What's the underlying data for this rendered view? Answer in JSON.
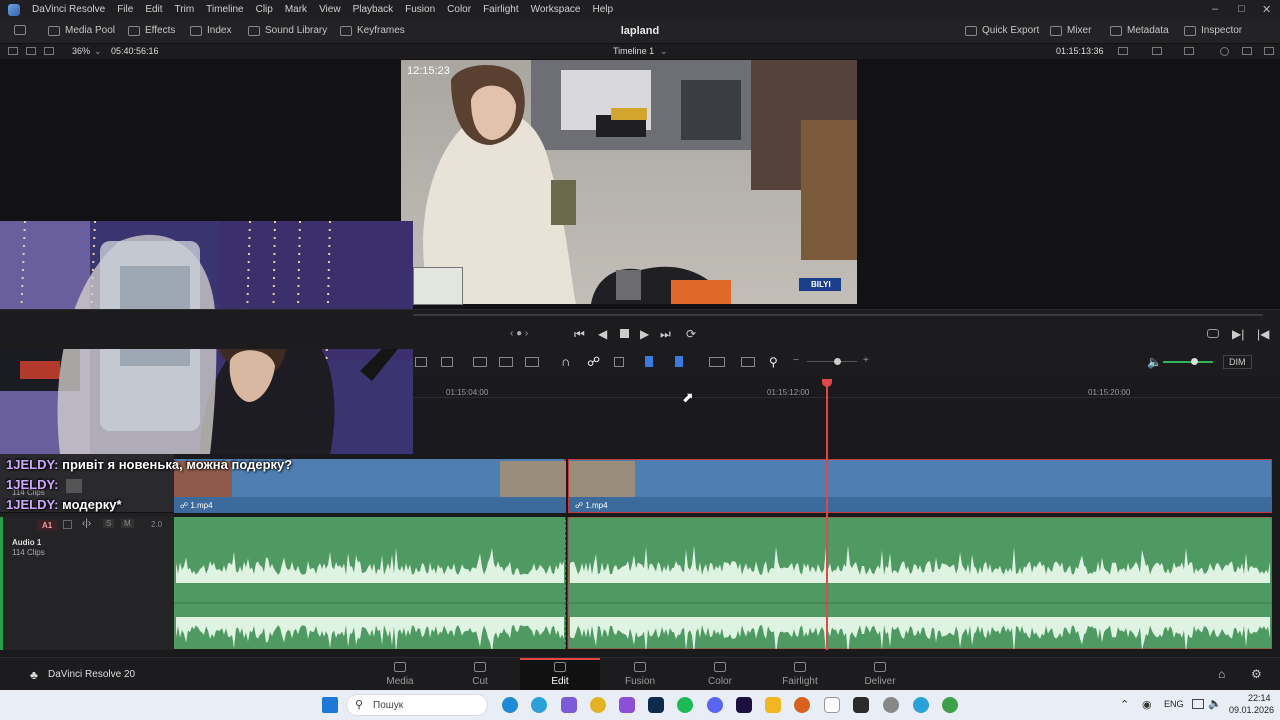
{
  "menubar": {
    "app_name": "DaVinci Resolve",
    "items": [
      "File",
      "Edit",
      "Trim",
      "Timeline",
      "Clip",
      "Mark",
      "View",
      "Playback",
      "Fusion",
      "Color",
      "Fairlight",
      "Workspace",
      "Help"
    ]
  },
  "toolbar": {
    "left": [
      "Media Pool",
      "Effects",
      "Index",
      "Sound Library",
      "Keyframes"
    ],
    "project_title": "lapland",
    "right": [
      "Quick Export",
      "Mixer",
      "Metadata",
      "Inspector"
    ]
  },
  "viewer": {
    "zoom": "36%",
    "source_timecode": "05:40:56:16",
    "timeline_name": "Timeline 1",
    "record_timecode": "01:15:13:36",
    "overlay_badge": "BILYI"
  },
  "ruler": {
    "ticks": [
      "01:15:04:00",
      "01:15:12:00",
      "01:15:20:00"
    ]
  },
  "tracks": {
    "video": {
      "clips_count": "114 Clips",
      "clip_names": [
        "1.mp4",
        "1.mp4"
      ]
    },
    "audio": {
      "badge": "A1",
      "name": "Audio 1",
      "clips_count": "114 Clips",
      "channels": "2.0",
      "solo": "S",
      "mute": "M"
    }
  },
  "mixer": {
    "dim_label": "DIM"
  },
  "chat": [
    {
      "user": "1JELDY:",
      "text": "привіт я новенька, можна подерку?"
    },
    {
      "user": "1JELDY:",
      "text": ""
    },
    {
      "user": "1JELDY:",
      "text": "модерку*"
    }
  ],
  "pages": {
    "brand": "DaVinci Resolve 20",
    "tabs": [
      "Media",
      "Cut",
      "Edit",
      "Fusion",
      "Color",
      "Fairlight",
      "Deliver"
    ],
    "active": "Edit"
  },
  "taskbar": {
    "search_placeholder": "Пошук",
    "language": "ENG",
    "time": "22:14",
    "date": "09.01.2026"
  },
  "colors": {
    "video_track": "#4f7fb2",
    "audio_track": "#4f9a63",
    "playhead": "#e24646",
    "active_tab_accent": "#e24646"
  }
}
